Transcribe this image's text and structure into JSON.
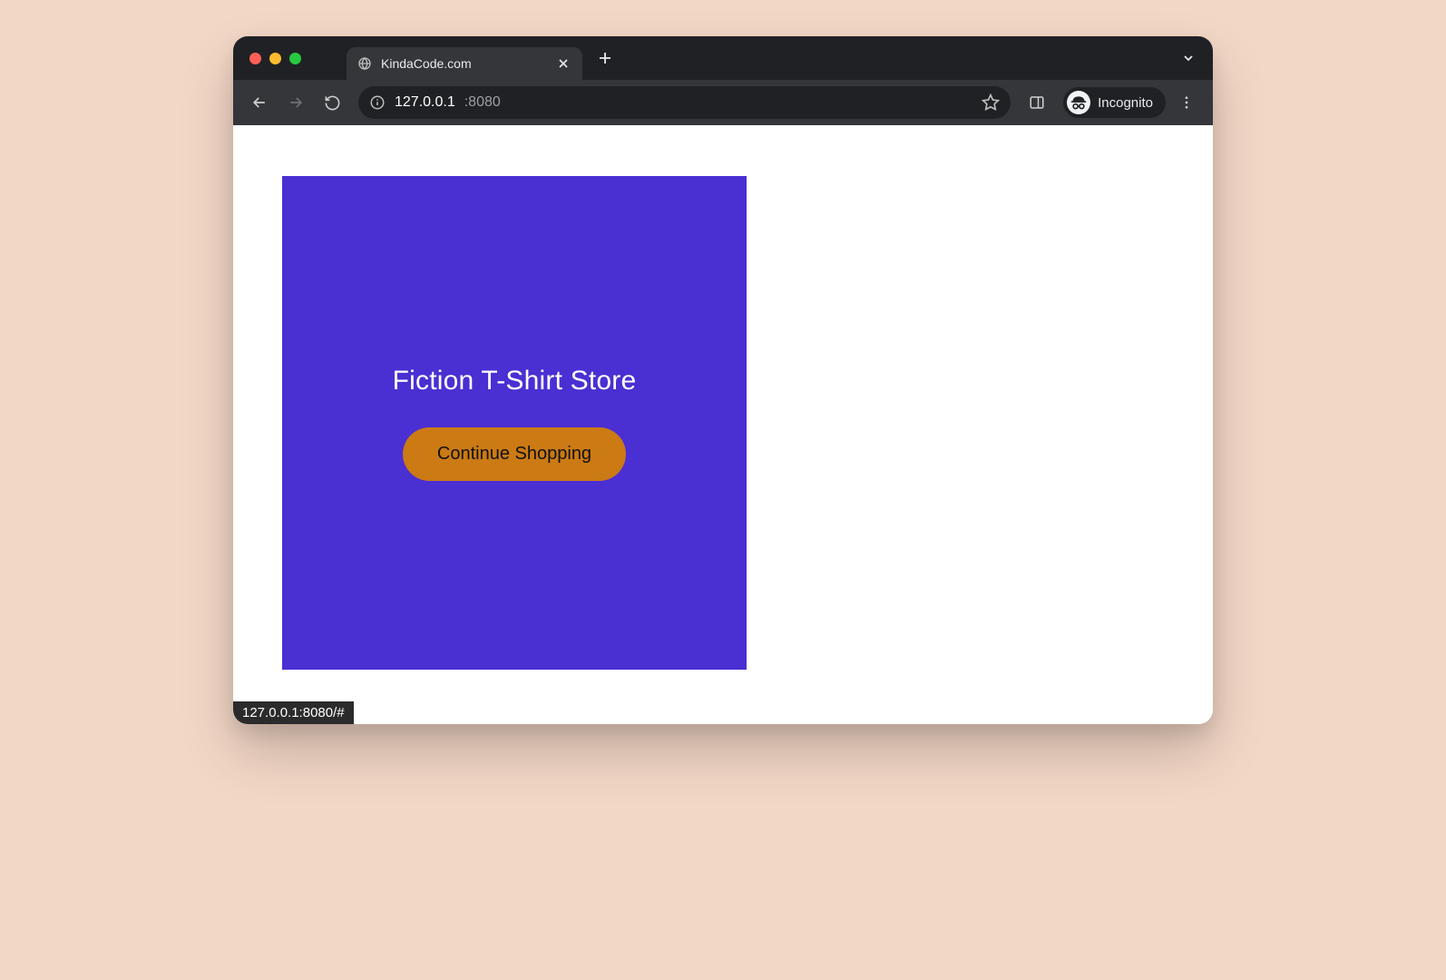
{
  "browser": {
    "tab": {
      "title": "KindaCode.com"
    },
    "address": {
      "host": "127.0.0.1",
      "port": ":8080"
    },
    "incognito_label": "Incognito",
    "status_text": "127.0.0.1:8080/#"
  },
  "page": {
    "card_title": "Fiction T-Shirt Store",
    "cta_label": "Continue Shopping"
  }
}
